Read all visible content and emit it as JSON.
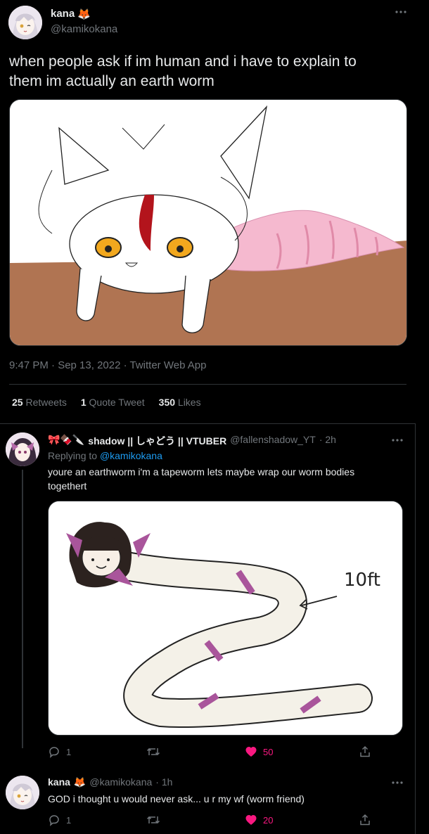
{
  "main_tweet": {
    "display_name": "kana",
    "emoji": "🦊",
    "handle": "@kamikokana",
    "text_line1": "when people ask if im human and i have to explain to",
    "text_line2": "them im actually an earth worm",
    "timestamp": "9:47 PM · Sep 13, 2022 · Twitter Web App",
    "stats": {
      "retweets_count": "25",
      "retweets_label": "Retweets",
      "quotes_count": "1",
      "quotes_label": "Quote Tweet",
      "likes_count": "350",
      "likes_label": "Likes"
    }
  },
  "reply1": {
    "prefix_emoji": "🎀🍫🔪",
    "display_name": "shadow || しゃどう || VTUBER",
    "handle": "@fallenshadow_YT",
    "time": "· 2h",
    "replying_label": "Replying to",
    "replying_handle": "@kamikokana",
    "text_line1": "youre an earthworm i'm a tapeworm lets maybe wrap our worm bodies",
    "text_line2": "togethert",
    "drawing_note": "10ft",
    "actions": {
      "replies": "1",
      "retweets": "",
      "likes": "50"
    }
  },
  "reply2": {
    "display_name": "kana",
    "emoji": "🦊",
    "handle": "@kamikokana",
    "time": "· 1h",
    "text": "GOD i thought u would never ask... u r my wf (worm friend)",
    "actions": {
      "replies": "1",
      "retweets": "",
      "likes": "20"
    }
  },
  "more_label": "···",
  "colors": {
    "background": "#000000",
    "text": "#e7e9ea",
    "muted": "#71767b",
    "link": "#1d9bf0",
    "like": "#f91880",
    "divider": "#2f3336",
    "dirt": "#b07452",
    "worm_pink": "#f5b9cf",
    "ribbon_purple": "#a9559b"
  },
  "icons": [
    "more-icon",
    "reply-icon",
    "retweet-icon",
    "like-icon",
    "share-icon"
  ]
}
